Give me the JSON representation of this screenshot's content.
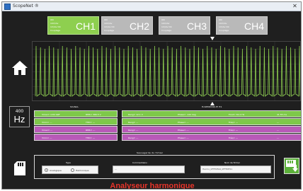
{
  "window": {
    "title": "ScopeNet ®",
    "close_icon": "close-icon"
  },
  "channels": [
    {
      "name": "CH1",
      "state": "active",
      "lines": [
        "ON",
        "10V/div",
        "1V/div DC",
        "Couplage"
      ]
    },
    {
      "name": "CH2",
      "state": "inactive",
      "lines": [
        "ON",
        "10V/div",
        "1V/div DC",
        "Couplage"
      ]
    },
    {
      "name": "CH3",
      "state": "inactive",
      "lines": [
        "ON",
        "10V/div",
        "1V/div DC",
        "Couplage"
      ]
    },
    {
      "name": "CH4",
      "state": "inactive",
      "lines": [
        "ON",
        "10V/div",
        "1V/div DC",
        "Couplage"
      ]
    }
  ],
  "sidebar": {
    "home_icon": "home-icon",
    "frequency": {
      "value": "400",
      "unit": "Hz"
    },
    "storage_icon": "sd-card-icon"
  },
  "measurements": {
    "signal_label": "SIGNAL",
    "harmonics_label": "HARMONIQUE H1",
    "signal_rows": [
      {
        "color": "green",
        "cells": [
          "Vmax= 4.84 Veff",
          "RMS= 366.5 V"
        ]
      },
      {
        "color": "green",
        "cells": [
          "Vmin= ---",
          "THD= ---"
        ]
      },
      {
        "color": "magenta",
        "cells": [
          "Vmax= ---",
          "RMS= ---"
        ]
      },
      {
        "color": "magenta",
        "cells": [
          "Vmin= ---",
          "THD= ---"
        ]
      }
    ],
    "harmonic_rows": [
      {
        "color": "green",
        "cells": [
          "Rang= 12.1 V",
          "Phase= -142 deg",
          "Fond= 61.0 Hz",
          "41.55 ms"
        ]
      },
      {
        "color": "green",
        "cells": [
          "Rang= ---",
          "Phase= ---",
          "Fréq= ---",
          "---"
        ]
      },
      {
        "color": "magenta",
        "cells": [
          "Rang= ---",
          "Phase= ---",
          "Fréq= ---",
          "---"
        ]
      },
      {
        "color": "magenta",
        "cells": [
          "Rang= ---",
          "Phase= ---",
          "Fréq= ---",
          "---"
        ]
      }
    ]
  },
  "save_panel": {
    "section_label": "Sauvegarde du fichier",
    "type_label": "Type",
    "type_options": [
      "Analogique",
      "Harmonique"
    ],
    "type_selected": "Analogique",
    "comment_label": "Commentaire :",
    "comment_value": "---",
    "filename_label": "Nom de fichier",
    "filename_value": "Harmo_0FFE0Fe9_0FFE0F21",
    "save_icon": "save-download-icon"
  },
  "caption": "Analyseur harmonique",
  "colors": {
    "accent_green": "#8ecf4f",
    "magenta": "#b85ab8",
    "caption_red": "#e8342a"
  }
}
